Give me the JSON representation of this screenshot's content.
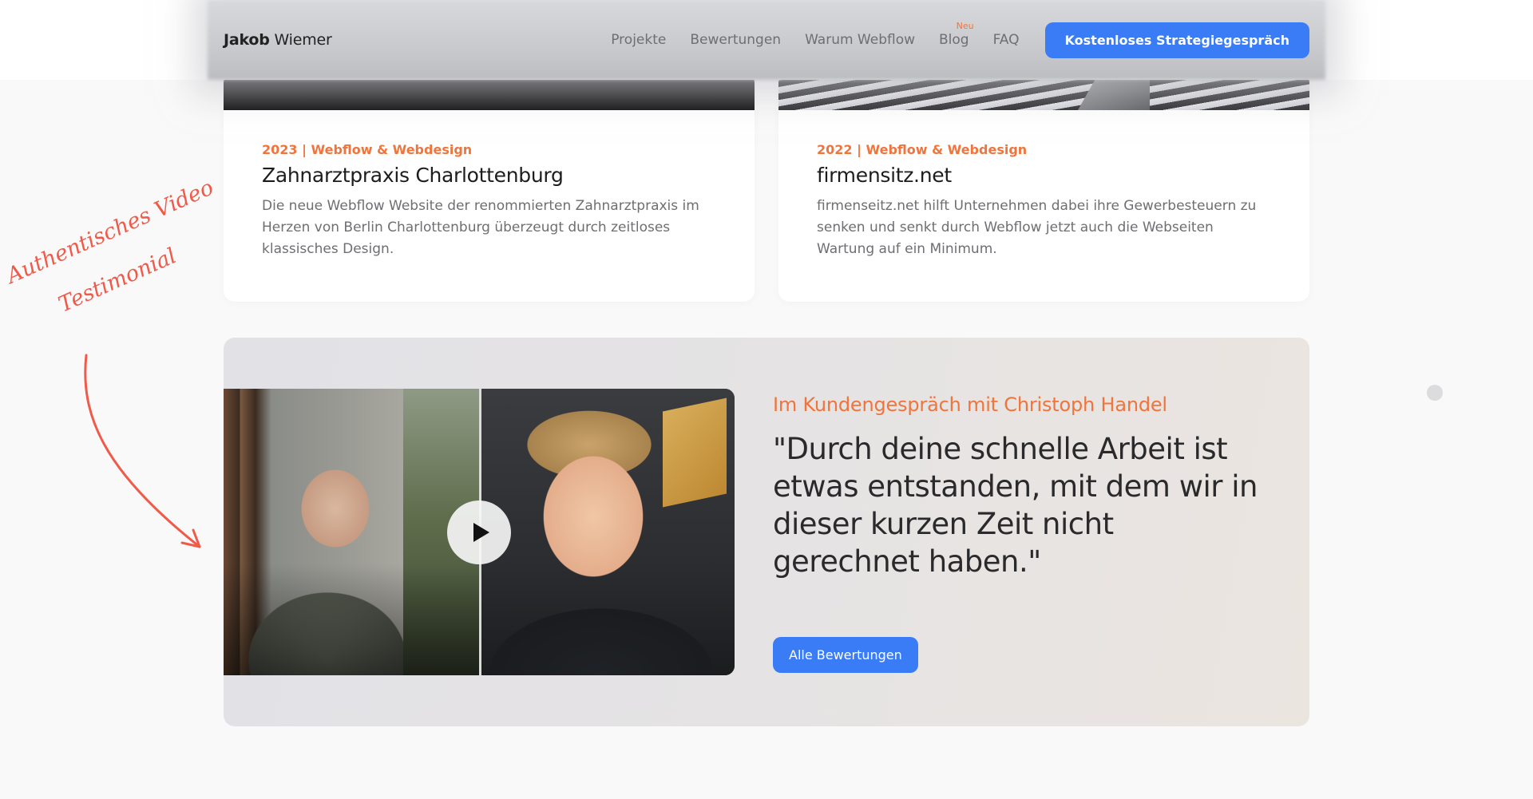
{
  "navbar": {
    "brand_first": "Jakob",
    "brand_last": "Wiemer",
    "links": [
      {
        "label": "Projekte"
      },
      {
        "label": "Bewertungen"
      },
      {
        "label": "Warum Webflow"
      },
      {
        "label": "Blog",
        "badge": "Neu"
      },
      {
        "label": "FAQ"
      }
    ],
    "cta_label": "Kostenloses Strategiegespräch"
  },
  "projects": [
    {
      "meta": "2023 | Webflow & Webdesign",
      "title": "Zahnarztpraxis Charlottenburg",
      "description": "Die neue Webflow Website der renommierten Zahnarztpraxis im Herzen von Berlin Charlottenburg überzeugt durch zeitloses klassisches Design."
    },
    {
      "meta": "2022 | Webflow & Webdesign",
      "title": "firmensitz.net",
      "description": "firmenseitz.net hilft Unternehmen dabei ihre Gewerbesteuern zu senken und senkt durch Webflow jetzt auch die Webseiten Wartung auf ein Minimum."
    }
  ],
  "annotation": {
    "line1": "Authentisches Video",
    "line2": "Testimonial"
  },
  "testimonial": {
    "kicker": "Im Kundengespräch mit Christoph Handel",
    "quote": "\"Durch deine schnelle Arbeit ist etwas entstanden, mit dem wir in dieser kurzen Zeit nicht gerechnet haben.\"",
    "button_label": "Alle Bewertungen"
  },
  "colors": {
    "accent_blue": "#3a7bf6",
    "accent_orange": "#f0743b",
    "annotation_red": "#f05a49",
    "background": "#f9f9f9"
  }
}
